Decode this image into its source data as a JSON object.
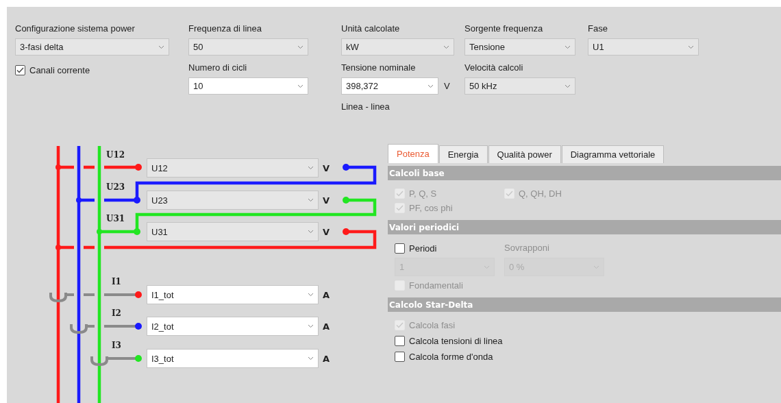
{
  "settings": [
    {
      "items": [
        {
          "kind": "select",
          "label": "Configurazione sistema power",
          "value": "3-fasi delta",
          "editable": false
        },
        {
          "kind": "checkbox",
          "label": "Canali corrente",
          "checked": true
        }
      ]
    },
    {
      "items": [
        {
          "kind": "select",
          "label": "Frequenza di linea",
          "value": "50",
          "editable": false
        },
        {
          "kind": "select",
          "label": "Numero di cicli",
          "value": "10",
          "editable": true
        }
      ]
    },
    {
      "items": [
        {
          "kind": "select",
          "label": "Unità calcolate",
          "value": "kW",
          "editable": false
        },
        {
          "kind": "select",
          "label": "Tensione nominale",
          "value": "398,372",
          "editable": true,
          "unit": "V",
          "note": "Linea - linea"
        }
      ]
    },
    {
      "items": [
        {
          "kind": "select",
          "label": "Sorgente frequenza",
          "value": "Tensione",
          "editable": false
        },
        {
          "kind": "select",
          "label": "Velocità calcoli",
          "value": "50 kHz",
          "editable": false
        }
      ]
    },
    {
      "items": [
        {
          "kind": "select",
          "label": "Fase",
          "value": "U1",
          "editable": false
        }
      ]
    }
  ],
  "voltage_channels": [
    {
      "label": "U12",
      "value": "U12",
      "unit": "V",
      "editable": false
    },
    {
      "label": "U23",
      "value": "U23",
      "unit": "V",
      "editable": false
    },
    {
      "label": "U31",
      "value": "U31",
      "unit": "V",
      "editable": false
    }
  ],
  "current_channels": [
    {
      "label": "I1",
      "value": "I1_tot",
      "unit": "A",
      "editable": true,
      "color": "#ff1a1a"
    },
    {
      "label": "I2",
      "value": "I2_tot",
      "unit": "A",
      "editable": true,
      "color": "#1a1aff"
    },
    {
      "label": "I3",
      "value": "I3_tot",
      "unit": "A",
      "editable": true,
      "color": "#22e622"
    }
  ],
  "tabs": [
    {
      "label": "Potenza",
      "selected": true
    },
    {
      "label": "Energia",
      "selected": false
    },
    {
      "label": "Qualità power",
      "selected": false
    },
    {
      "label": "Diagramma vettoriale",
      "selected": false
    }
  ],
  "sections": [
    {
      "title": "Calcoli base",
      "two_columns": true,
      "items": [
        {
          "kind": "checkbox",
          "label": "P, Q, S",
          "checked": true,
          "disabled": true
        },
        {
          "kind": "checkbox",
          "label": "Q, QH, DH",
          "checked": true,
          "disabled": true
        },
        {
          "kind": "checkbox",
          "label": "PF, cos phi",
          "checked": true,
          "disabled": true
        }
      ]
    },
    {
      "title": "Valori periodici",
      "two_columns": true,
      "items": [
        {
          "kind": "checkbox",
          "label": "Periodi",
          "checked": false,
          "disabled": false
        },
        {
          "kind": "label",
          "label": "Sovrapponi",
          "disabled": true
        },
        {
          "kind": "select",
          "value": "1",
          "disabled": true
        },
        {
          "kind": "select",
          "value": "0 %",
          "disabled": true
        },
        {
          "kind": "checkbox",
          "label": "Fondamentali",
          "checked": false,
          "disabled": true
        }
      ]
    },
    {
      "title": "Calcolo Star-Delta",
      "two_columns": false,
      "items": [
        {
          "kind": "checkbox",
          "label": "Calcola fasi",
          "checked": true,
          "disabled": true
        },
        {
          "kind": "checkbox",
          "label": "Calcola tensioni di linea",
          "checked": false,
          "disabled": false
        },
        {
          "kind": "checkbox",
          "label": "Calcola forme d'onda",
          "checked": false,
          "disabled": false
        }
      ]
    }
  ]
}
